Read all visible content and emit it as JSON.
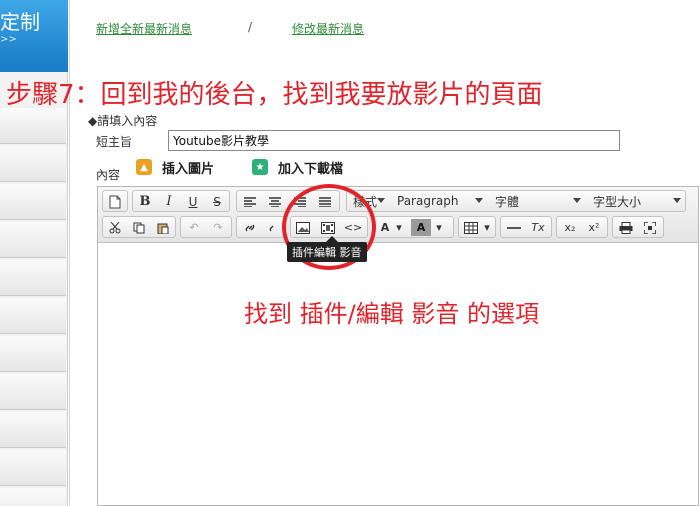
{
  "sidebar": {
    "title": "定制",
    "subtitle": ">>"
  },
  "top_links": {
    "add_label": "新增全新最新消息",
    "separator": "/",
    "edit_label": "修改最新消息"
  },
  "captions": {
    "step": "步驟7：回到我的後台，找到我要放影片的頁面",
    "find": "找到 插件/編輯 影音 的選項"
  },
  "form": {
    "fill_label": "◆請填入內容",
    "subject_label": "短主旨",
    "subject_value": "Youtube影片教學",
    "content_label": "內容"
  },
  "buttons": {
    "insert_image": "插入圖片",
    "add_download": "加入下載檔"
  },
  "toolbar": {
    "row1": {
      "bold": "B",
      "italic": "I",
      "underline": "U",
      "strike": "S",
      "style_dropdown": "樣式",
      "format_dropdown": "Paragraph",
      "font_dropdown": "字體",
      "size_dropdown": "字型大小"
    },
    "row2": {
      "source": "<>",
      "text_color": "A",
      "bg_color": "A",
      "subscript": "x₂",
      "superscript": "x²",
      "remove_format": "Tx"
    },
    "tooltip": "插件編輯 影音"
  },
  "colors": {
    "accent_red": "#e0242b",
    "link_green": "#2f8a3a",
    "sidebar_blue": "#1b7fc9"
  }
}
